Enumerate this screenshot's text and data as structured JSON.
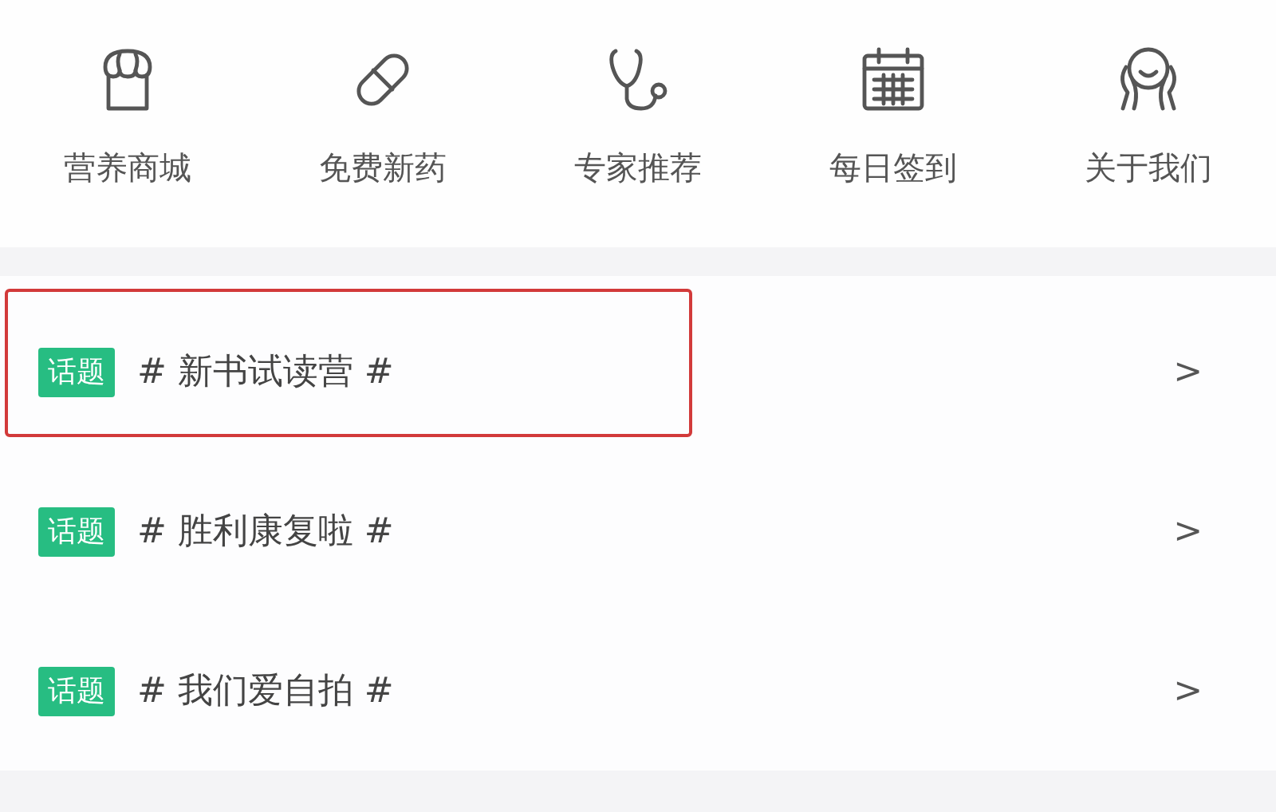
{
  "menu": [
    {
      "kind": "shop",
      "label": "营养商城"
    },
    {
      "kind": "pill",
      "label": "免费新药"
    },
    {
      "kind": "stethoscope",
      "label": "专家推荐"
    },
    {
      "kind": "calendar",
      "label": "每日签到"
    },
    {
      "kind": "hands",
      "label": "关于我们"
    }
  ],
  "topics": [
    {
      "tag": "话题",
      "title": "# 新书试读营 #",
      "arrow": ">",
      "highlighted": true
    },
    {
      "tag": "话题",
      "title": "# 胜利康复啦 #",
      "arrow": ">",
      "highlighted": false
    },
    {
      "tag": "话题",
      "title": "# 我们爱自拍 #",
      "arrow": ">",
      "highlighted": false
    }
  ]
}
